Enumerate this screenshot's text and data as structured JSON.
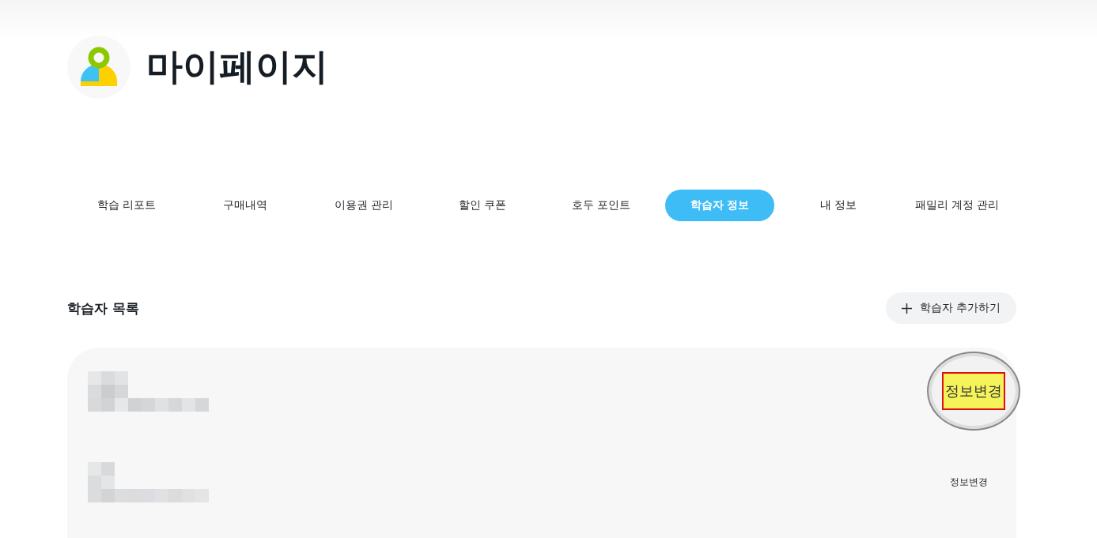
{
  "page_title": "마이페이지",
  "tabs": [
    {
      "label": "학습 리포트",
      "selected": false
    },
    {
      "label": "구매내역",
      "selected": false
    },
    {
      "label": "이용권 관리",
      "selected": false
    },
    {
      "label": "할인 쿠폰",
      "selected": false
    },
    {
      "label": "호두 포인트",
      "selected": false
    },
    {
      "label": "학습자 정보",
      "selected": true
    },
    {
      "label": "내 정보",
      "selected": false
    },
    {
      "label": "패밀리 계정 관리",
      "selected": false
    }
  ],
  "section": {
    "title": "학습자 목록",
    "add_button": "학습자 추가하기"
  },
  "learners": [
    {
      "edit_button": "정보변경",
      "highlighted": true
    },
    {
      "edit_button": "정보변경",
      "highlighted": false
    }
  ]
}
